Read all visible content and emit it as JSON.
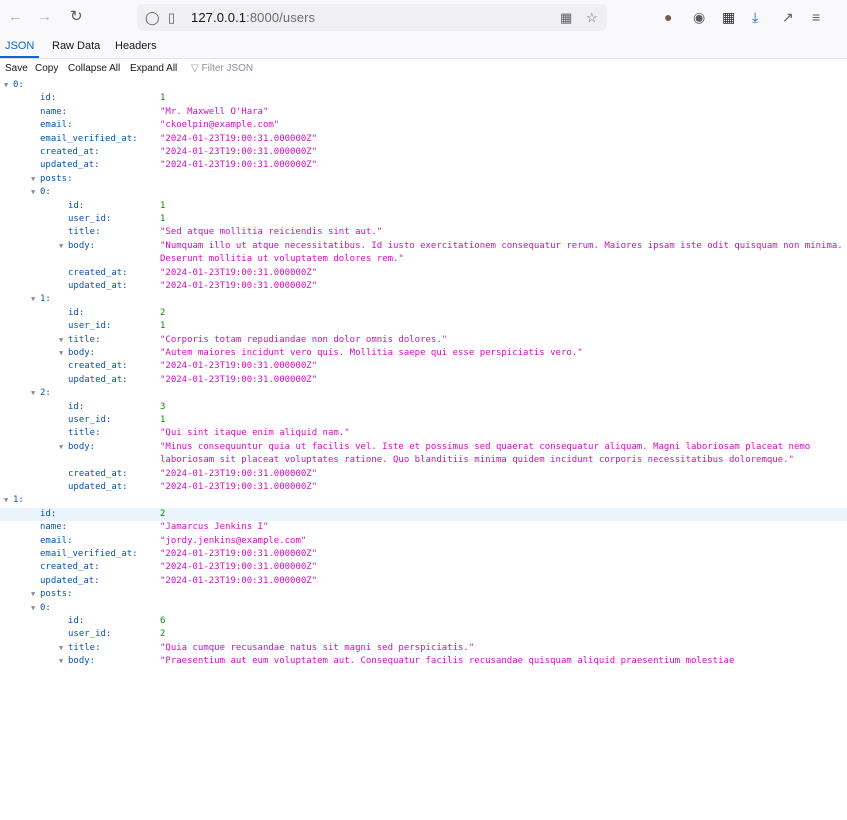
{
  "browser": {
    "back_icon": "arrow-left-icon",
    "forward_icon": "arrow-right-icon",
    "reload_icon": "reload-icon",
    "url_host": "127.0.0.1",
    "url_path": ":8000/users"
  },
  "viewer": {
    "tabs": [
      "JSON",
      "Raw Data",
      "Headers"
    ],
    "actions": [
      "Save",
      "Copy",
      "Collapse All",
      "Expand All"
    ],
    "filter_placeholder": "Filter JSON"
  },
  "rows": [
    {
      "key": "0:",
      "indent": 0,
      "twisty": true
    },
    {
      "key": "id:",
      "indent": 1,
      "value": "1",
      "type": "num"
    },
    {
      "key": "name:",
      "indent": 1,
      "value": "\"Mr. Maxwell O'Hara\"",
      "type": "str"
    },
    {
      "key": "email:",
      "indent": 1,
      "value": "\"ckoelpin@example.com\"",
      "type": "str"
    },
    {
      "key": "email_verified_at:",
      "indent": 1,
      "value": "\"2024-01-23T19:00:31.000000Z\"",
      "type": "str"
    },
    {
      "key": "created_at:",
      "indent": 1,
      "value": "\"2024-01-23T19:00:31.000000Z\"",
      "type": "str"
    },
    {
      "key": "updated_at:",
      "indent": 1,
      "value": "\"2024-01-23T19:00:31.000000Z\"",
      "type": "str"
    },
    {
      "key": "posts:",
      "indent": 1,
      "twisty": true
    },
    {
      "key": "0:",
      "indent": 2,
      "twisty": true
    },
    {
      "key": "id:",
      "indent": 3,
      "value": "1",
      "type": "num"
    },
    {
      "key": "user_id:",
      "indent": 3,
      "value": "1",
      "type": "num"
    },
    {
      "key": "title:",
      "indent": 3,
      "value": "\"Sed atque mollitia reiciendis sint aut.\"",
      "type": "str"
    },
    {
      "key": "body:",
      "indent": 3,
      "twisty": true,
      "value": "\"Numquam illo ut atque necessitatibus. Id iusto exercitationem consequatur rerum. Maiores ipsam iste odit quisquam non minima. Deserunt mollitia ut voluptatem dolores rem.\"",
      "type": "str",
      "lines": 2
    },
    {
      "key": "created_at:",
      "indent": 3,
      "value": "\"2024-01-23T19:00:31.000000Z\"",
      "type": "str"
    },
    {
      "key": "updated_at:",
      "indent": 3,
      "value": "\"2024-01-23T19:00:31.000000Z\"",
      "type": "str"
    },
    {
      "key": "1:",
      "indent": 2,
      "twisty": true
    },
    {
      "key": "id:",
      "indent": 3,
      "value": "2",
      "type": "num"
    },
    {
      "key": "user_id:",
      "indent": 3,
      "value": "1",
      "type": "num"
    },
    {
      "key": "title:",
      "indent": 3,
      "twisty": true,
      "value": "\"Corporis totam repudiandae non dolor omnis dolores.\"",
      "type": "str"
    },
    {
      "key": "body:",
      "indent": 3,
      "twisty": true,
      "value": "\"Autem maiores incidunt vero quis. Mollitia saepe qui esse perspiciatis vero.\"",
      "type": "str"
    },
    {
      "key": "created_at:",
      "indent": 3,
      "value": "\"2024-01-23T19:00:31.000000Z\"",
      "type": "str"
    },
    {
      "key": "updated_at:",
      "indent": 3,
      "value": "\"2024-01-23T19:00:31.000000Z\"",
      "type": "str"
    },
    {
      "key": "2:",
      "indent": 2,
      "twisty": true
    },
    {
      "key": "id:",
      "indent": 3,
      "value": "3",
      "type": "num"
    },
    {
      "key": "user_id:",
      "indent": 3,
      "value": "1",
      "type": "num"
    },
    {
      "key": "title:",
      "indent": 3,
      "value": "\"Qui sint itaque enim aliquid nam.\"",
      "type": "str"
    },
    {
      "key": "body:",
      "indent": 3,
      "twisty": true,
      "value": "\"Minus consequuntur quia ut facilis vel. Iste et possimus sed quaerat consequatur aliquam. Magni laboriosam placeat nemo laboriosam sit placeat voluptates ratione. Quo blanditiis minima quidem incidunt corporis necessitatibus doloremque.\"",
      "type": "str",
      "lines": 2
    },
    {
      "key": "created_at:",
      "indent": 3,
      "value": "\"2024-01-23T19:00:31.000000Z\"",
      "type": "str"
    },
    {
      "key": "updated_at:",
      "indent": 3,
      "value": "\"2024-01-23T19:00:31.000000Z\"",
      "type": "str"
    },
    {
      "key": "1:",
      "indent": 0,
      "twisty": true
    },
    {
      "key": "id:",
      "indent": 1,
      "value": "2",
      "type": "num",
      "highlight": true
    },
    {
      "key": "name:",
      "indent": 1,
      "value": "\"Jamarcus Jenkins I\"",
      "type": "str"
    },
    {
      "key": "email:",
      "indent": 1,
      "value": "\"jordy.jenkins@example.com\"",
      "type": "str"
    },
    {
      "key": "email_verified_at:",
      "indent": 1,
      "value": "\"2024-01-23T19:00:31.000000Z\"",
      "type": "str"
    },
    {
      "key": "created_at:",
      "indent": 1,
      "value": "\"2024-01-23T19:00:31.000000Z\"",
      "type": "str"
    },
    {
      "key": "updated_at:",
      "indent": 1,
      "value": "\"2024-01-23T19:00:31.000000Z\"",
      "type": "str"
    },
    {
      "key": "posts:",
      "indent": 1,
      "twisty": true
    },
    {
      "key": "0:",
      "indent": 2,
      "twisty": true
    },
    {
      "key": "id:",
      "indent": 3,
      "value": "6",
      "type": "num"
    },
    {
      "key": "user_id:",
      "indent": 3,
      "value": "2",
      "type": "num"
    },
    {
      "key": "title:",
      "indent": 3,
      "twisty": true,
      "value": "\"Quia cumque recusandae natus sit magni sed perspiciatis.\"",
      "type": "str"
    },
    {
      "key": "body:",
      "indent": 3,
      "twisty": true,
      "value": "\"Praesentium aut eum voluptatem aut. Consequatur facilis recusandae quisquam aliquid praesentium molestiae",
      "type": "str"
    }
  ],
  "colors": {
    "key": "#0a52b0",
    "number": "#058b00",
    "string": "#d30dbe",
    "accent": "#0a65d6",
    "highlight": "#eaf4fd"
  }
}
